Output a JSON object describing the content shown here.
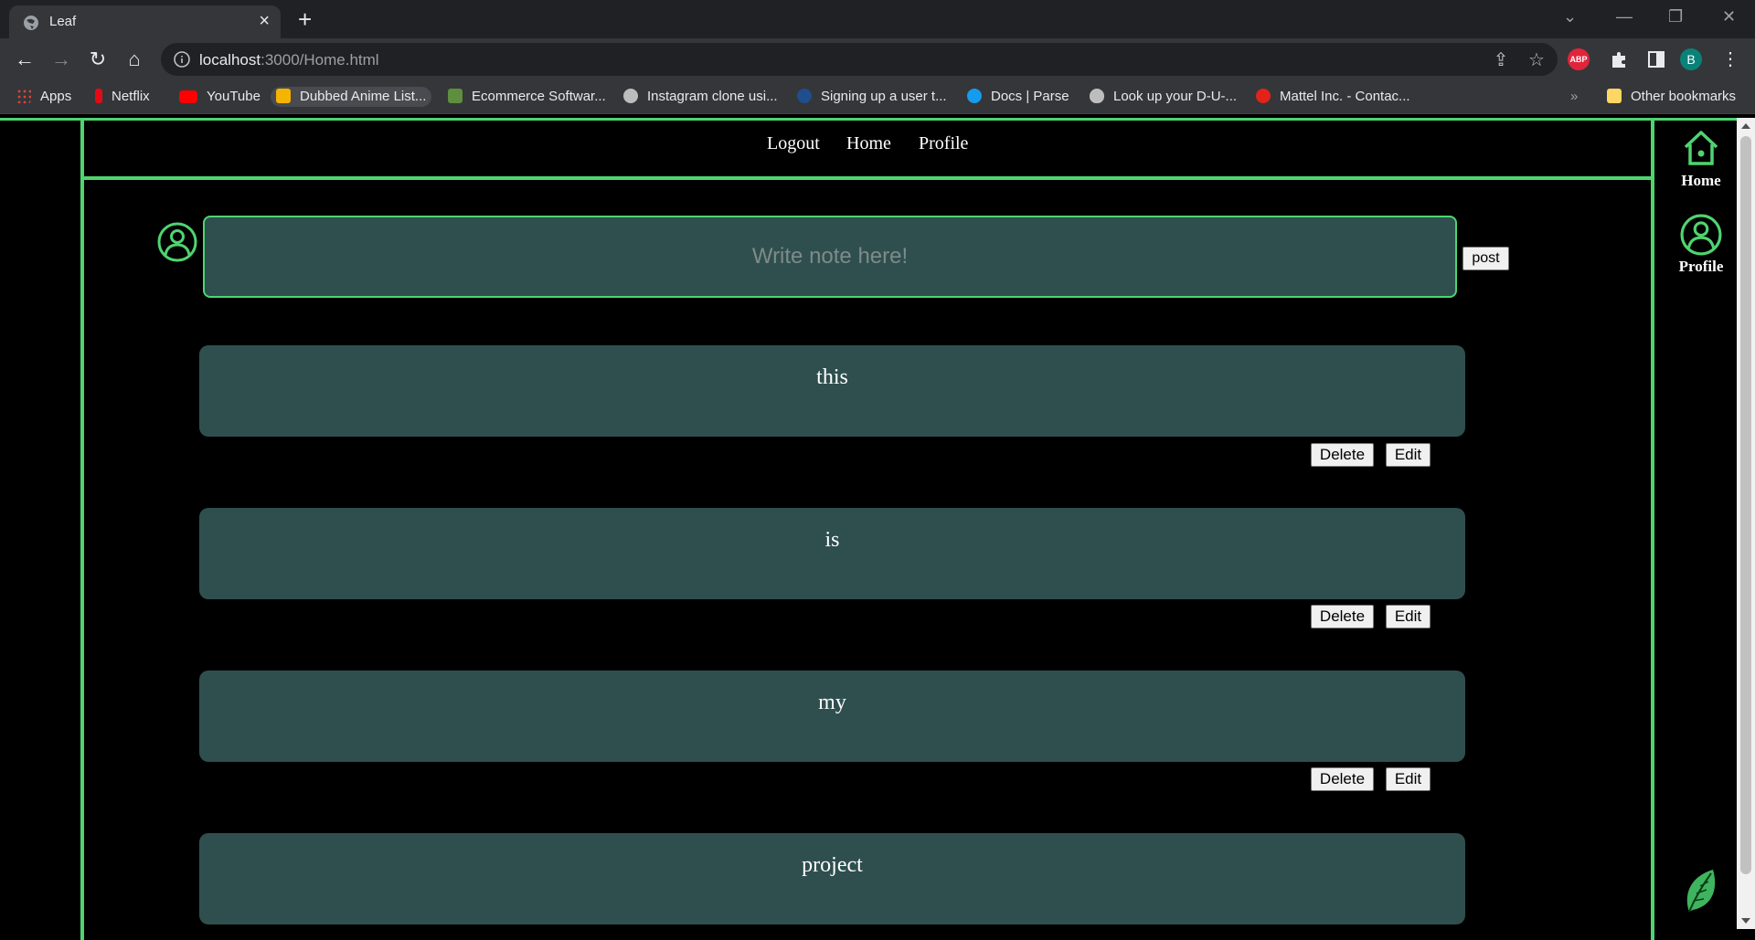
{
  "browser": {
    "tab_title": "Leaf",
    "url_host": "localhost",
    "url_rest": ":3000/Home.html",
    "avatar_letter": "B",
    "abp_label": "ABP",
    "bookmarks": [
      {
        "label": "Apps",
        "color": "#e8453c"
      },
      {
        "label": "Netflix",
        "color": "#e50914"
      },
      {
        "label": "YouTube",
        "color": "#ff0000"
      },
      {
        "label": "Dubbed Anime List...",
        "color": "#f4b400"
      },
      {
        "label": "Ecommerce Softwar...",
        "color": "#5e8e3e"
      },
      {
        "label": "Instagram clone usi...",
        "color": "#bdbdbd"
      },
      {
        "label": "Signing up a user t...",
        "color": "#1e4f8c"
      },
      {
        "label": "Docs | Parse",
        "color": "#169cee"
      },
      {
        "label": "Look up your D-U-...",
        "color": "#bdbdbd"
      },
      {
        "label": "Mattel Inc. - Contac...",
        "color": "#e2231a"
      }
    ],
    "other_bookmarks": "Other bookmarks"
  },
  "nav": {
    "logout": "Logout",
    "home": "Home",
    "profile": "Profile"
  },
  "composer": {
    "placeholder": "Write note here!",
    "post_label": "post"
  },
  "notes": [
    {
      "text": "this"
    },
    {
      "text": "is"
    },
    {
      "text": "my"
    },
    {
      "text": "project"
    }
  ],
  "note_actions": {
    "delete_label": "Delete",
    "edit_label": "Edit"
  },
  "sidebar": {
    "home_label": "Home",
    "profile_label": "Profile"
  },
  "theme": {
    "accent": "#4fd46f",
    "note_bg": "#2f4f4f",
    "background": "#000000"
  }
}
